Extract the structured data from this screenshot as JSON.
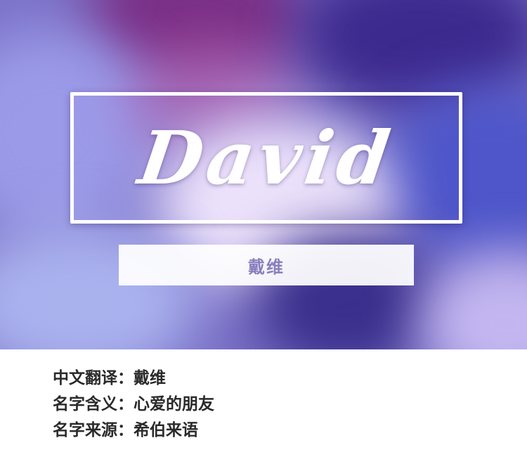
{
  "hero": {
    "english_name": "David",
    "chinese_name": "戴维"
  },
  "info": {
    "rows": [
      {
        "label": "中文翻译：",
        "value": "戴维"
      },
      {
        "label": "名字含义：",
        "value": "心爱的朋友"
      },
      {
        "label": "名字来源：",
        "value": "希伯来语"
      }
    ]
  },
  "colors": {
    "frame": "#ffffff",
    "translation_text": "#8a7fbf",
    "info_text": "#2a2a2a",
    "background_accent": "#7b72c8"
  }
}
